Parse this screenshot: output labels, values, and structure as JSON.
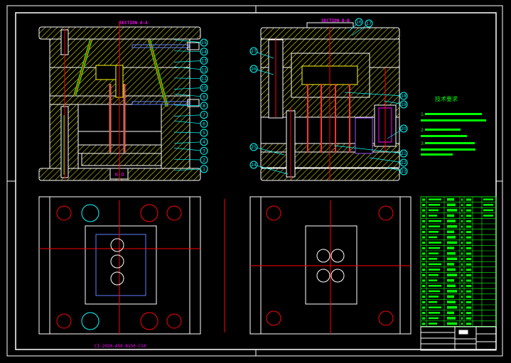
{
  "colors": {
    "background": "#000000",
    "outline": "#ffffff",
    "hatch": "#ffff00",
    "centerline": "#ff0000",
    "leader": "#00ffff",
    "balloon": "#00ffff",
    "text_magenta": "#ff00ff",
    "table": "#00ff00",
    "pin": "#ff3333",
    "ejector": "#c87864",
    "blue": "#6080ff"
  },
  "views": {
    "section_a": {
      "title": "SECTION A-A",
      "marker": "K-O"
    },
    "section_b": {
      "title": "SECTION B-B"
    },
    "plan_left": {
      "caption": "CI-2020-A50-B150-C10"
    }
  },
  "balloons_a": [
    "15",
    "14",
    "13",
    "12",
    "11",
    "10",
    "9",
    "8",
    "7",
    "6",
    "5",
    "4",
    "3",
    "2",
    "1"
  ],
  "balloons_b": {
    "left": [
      "27",
      "26",
      "25",
      "24"
    ],
    "right": [
      "18",
      "19",
      "20",
      "21",
      "22",
      "23"
    ],
    "top": [
      "16",
      "17"
    ]
  },
  "tech_requirements": {
    "title": "技术要求",
    "items": [
      "1.",
      "2.",
      "3."
    ]
  },
  "bom": {
    "rows": 24
  },
  "title_block": {}
}
